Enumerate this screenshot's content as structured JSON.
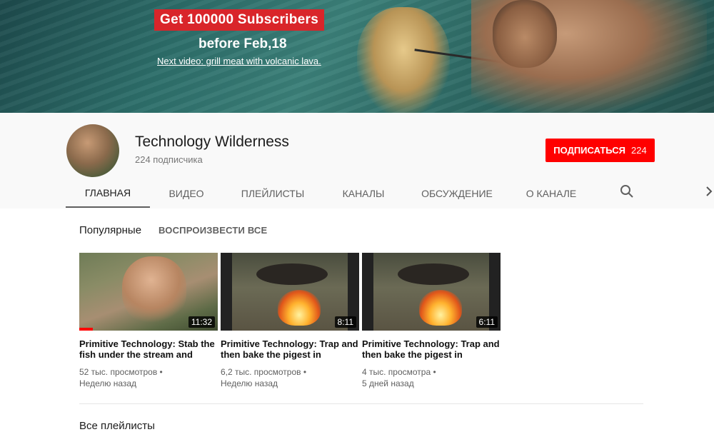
{
  "banner": {
    "title": "Get 100000 Subscribers",
    "subtitle": "before Feb,18",
    "next_video": "Next video: grill meat with volcanic lava."
  },
  "channel": {
    "name": "Technology Wilderness",
    "subscribers": "224 подписчика",
    "subscribe_label": "ПОДПИСАТЬСЯ",
    "subscribe_count": "224"
  },
  "tabs": [
    {
      "label": "ГЛАВНАЯ",
      "active": true
    },
    {
      "label": "ВИДЕО"
    },
    {
      "label": "ПЛЕЙЛИСТЫ"
    },
    {
      "label": "КАНАЛЫ"
    },
    {
      "label": "ОБСУЖДЕНИЕ"
    },
    {
      "label": "О КАНАЛЕ"
    }
  ],
  "icons": {
    "search": "search-icon",
    "next": "chevron-right-icon"
  },
  "popular": {
    "heading": "Популярные",
    "play_all": "ВОСПРОИЗВЕСТИ ВСЕ",
    "videos": [
      {
        "title": "Primitive Technology: Stab the fish under the stream and",
        "duration": "11:32",
        "views": "52 тыс. просмотров •",
        "age": "Неделю назад",
        "watched_fraction": 0.1
      },
      {
        "title": "Primitive Technology: Trap and then bake the pigest in",
        "duration": "8:11",
        "views": "6,2 тыс. просмотров •",
        "age": "Неделю назад"
      },
      {
        "title": "Primitive Technology: Trap and then bake the pigest in",
        "duration": "6:11",
        "views": "4 тыс. просмотра •",
        "age": "5 дней назад"
      }
    ]
  },
  "playlists": {
    "heading": "Все плейлисты"
  },
  "colors": {
    "accent": "#ff0000",
    "banner_red": "#d9252a"
  }
}
